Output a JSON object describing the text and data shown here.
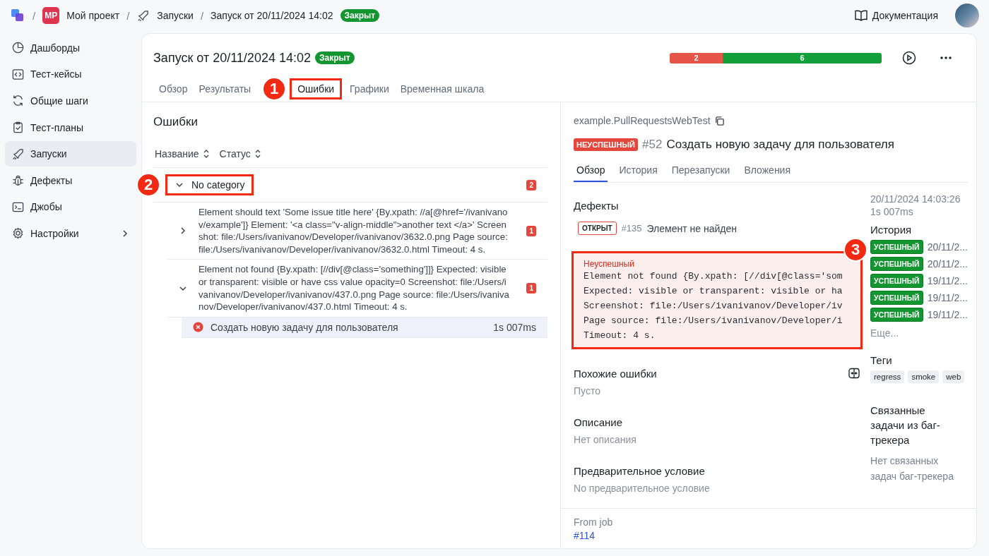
{
  "breadcrumb": {
    "separators": [
      "/",
      "/",
      "/"
    ],
    "project_initials": "MP",
    "project": "Мой проект",
    "section": "Запуски",
    "current": "Запуск от 20/11/2024 14:02",
    "status": "Закрыт"
  },
  "header_right": {
    "docs": "Документация"
  },
  "sidebar": {
    "items": [
      {
        "label": "Дашборды",
        "selected": false,
        "expandable": false
      },
      {
        "label": "Тест-кейсы",
        "selected": false,
        "expandable": false
      },
      {
        "label": "Общие шаги",
        "selected": false,
        "expandable": false
      },
      {
        "label": "Тест-планы",
        "selected": false,
        "expandable": false
      },
      {
        "label": "Запуски",
        "selected": true,
        "expandable": false
      },
      {
        "label": "Дефекты",
        "selected": false,
        "expandable": false
      },
      {
        "label": "Джобы",
        "selected": false,
        "expandable": false
      },
      {
        "label": "Настройки",
        "selected": false,
        "expandable": true
      }
    ]
  },
  "launch": {
    "title": "Запуск от 20/11/2024 14:02",
    "status": "Закрыт",
    "stats": [
      {
        "count": "2",
        "color": "#e5554a"
      },
      {
        "count": "6",
        "color": "#13a03a"
      }
    ],
    "tabs": [
      {
        "label": "Обзор",
        "selected": false
      },
      {
        "label": "Результаты",
        "selected": false
      },
      {
        "label": "Ошибки",
        "selected": true,
        "annotation": "1"
      },
      {
        "label": "Графики",
        "selected": false
      },
      {
        "label": "Временная шкала",
        "selected": false
      }
    ]
  },
  "errors": {
    "title": "Ошибки",
    "columns": [
      "Название",
      "Статус"
    ],
    "category": {
      "label": "No category",
      "count": "2",
      "expanded": true,
      "annotation": "2"
    },
    "items": [
      {
        "message": "Element should text 'Some issue title here' {By.xpath: //a[@href='/ivanivanov/example']} Element: '<a class=\"v-align-middle\">another text </a>' Screenshot: file:/Users/ivanivanov/Developer/ivanivanov/3632.0.png Page source: file:/Users/ivanivanov/Developer/ivanivanov/3632.0.html Timeout: 4 s.",
        "count": "1",
        "expanded": false
      },
      {
        "message": "Element not found {By.xpath: [//div[@class='something']]} Expected: visible or transparent: visible or have css value opacity=0 Screenshot: file:/Users/ivanivanov/Developer/ivanivanov/437.0.png Page source: file:/Users/ivanivanov/Developer/ivanivanov/437.0.html Timeout: 4 s.",
        "count": "1",
        "expanded": true,
        "tests": [
          {
            "name": "Создать новую задачу для пользователя",
            "duration": "1s 007ms",
            "selected": true
          }
        ]
      }
    ]
  },
  "detail": {
    "class_name": "example.PullRequestsWebTest",
    "status": "НЕУСПЕШНЫЙ",
    "number": "#52",
    "title": "Создать новую задачу для пользователя",
    "tabs": [
      {
        "label": "Обзор",
        "selected": true
      },
      {
        "label": "История",
        "selected": false
      },
      {
        "label": "Перезапуски",
        "selected": false
      },
      {
        "label": "Вложения",
        "selected": false
      }
    ],
    "defects_title": "Дефекты",
    "defect": {
      "status": "ОТКРЫТ",
      "number": "#135",
      "title": "Элемент не найден"
    },
    "error_box": {
      "status": "Неуспешный",
      "annotation": "3",
      "lines": [
        "Element not found {By.xpath: [//div[@class='som",
        "Expected: visible or transparent: visible or ha",
        "Screenshot: file:/Users/ivanivanov/Developer/iv",
        "Page source: file:/Users/ivanivanov/Developer/i",
        "Timeout: 4 s."
      ]
    },
    "sections": [
      {
        "title": "Похожие ошибки",
        "value": "Пусто",
        "action": true
      },
      {
        "title": "Описание",
        "value": "Нет описания"
      },
      {
        "title": "Предварительное условие",
        "value": "No предварительное условие"
      }
    ],
    "started": "20/11/2024 14:03:26",
    "duration": "1s 007ms",
    "history_title": "История",
    "history": [
      {
        "status": "УСПЕШНЫЙ",
        "date": "20/11/2..."
      },
      {
        "status": "УСПЕШНЫЙ",
        "date": "20/11/2..."
      },
      {
        "status": "УСПЕШНЫЙ",
        "date": "19/11/2..."
      },
      {
        "status": "УСПЕШНЫЙ",
        "date": "19/11/2..."
      },
      {
        "status": "УСПЕШНЫЙ",
        "date": "19/11/2..."
      }
    ],
    "history_more": "Еще...",
    "tags_title": "Теги",
    "tags": [
      "regress",
      "smoke",
      "web"
    ],
    "related_title": "Связанные задачи из баг-трекера",
    "related_value": "Нет связанных задач баг-трекера",
    "job_label": "From job",
    "job_link": "#114"
  }
}
